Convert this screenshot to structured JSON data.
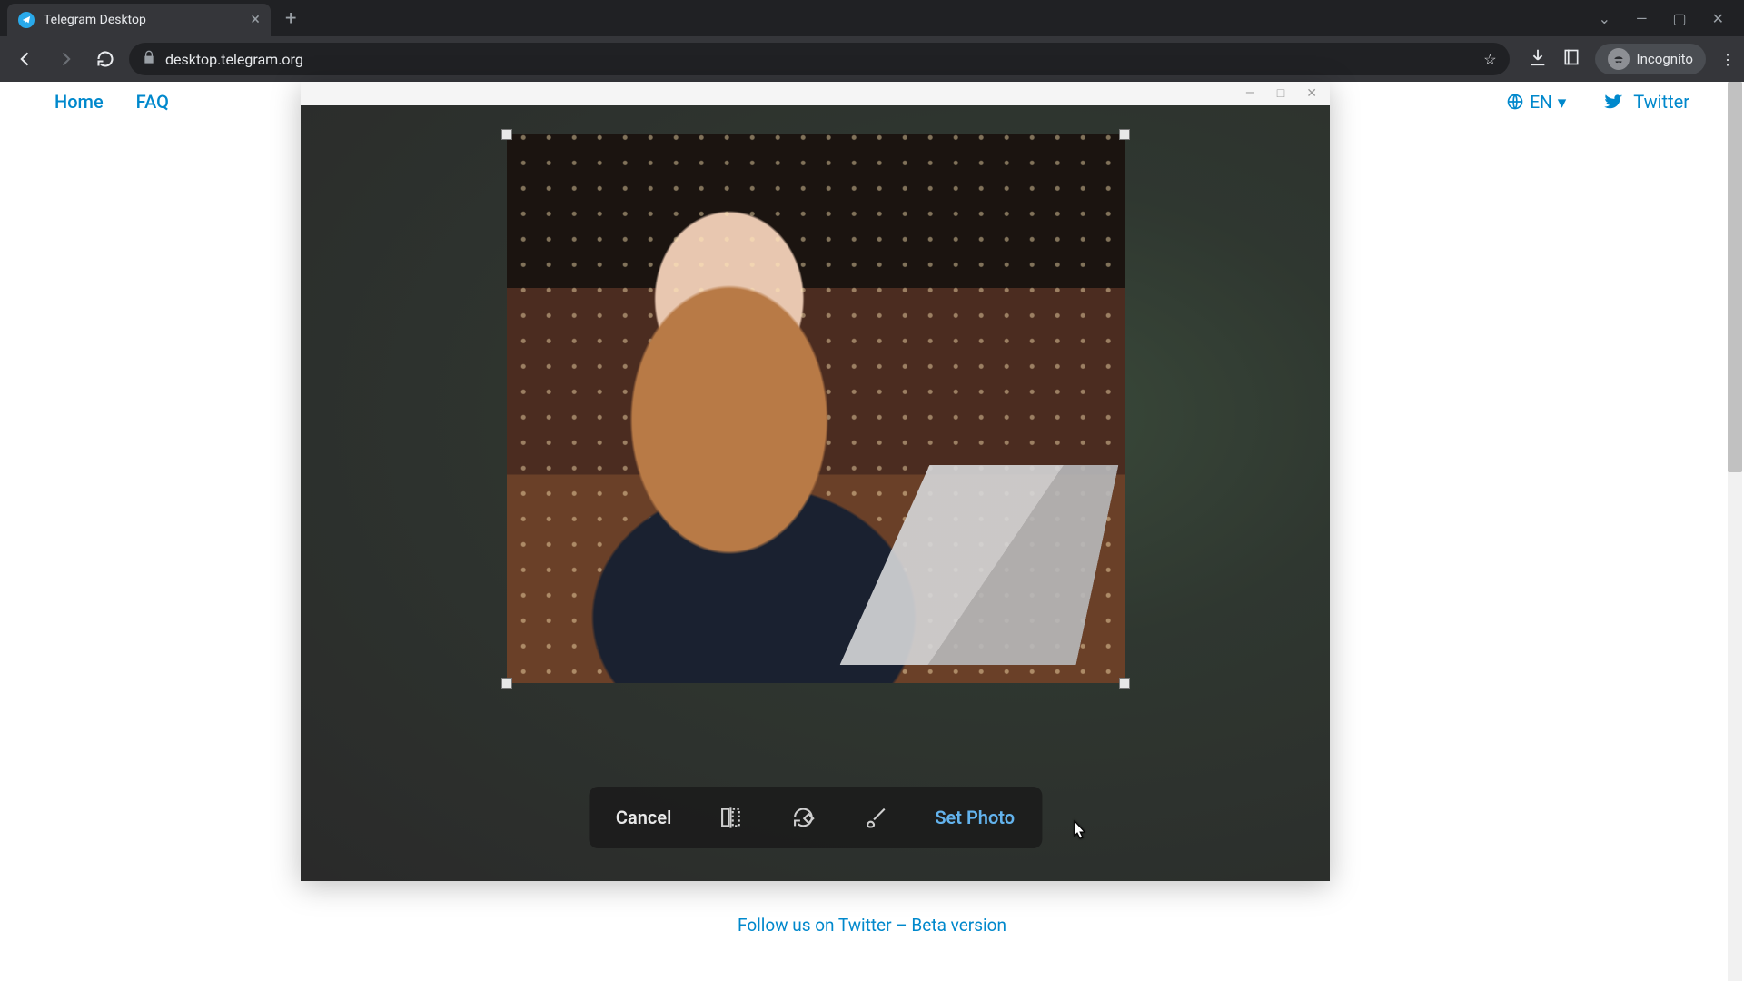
{
  "browser": {
    "tab_title": "Telegram Desktop",
    "url": "desktop.telegram.org",
    "incognito_label": "Incognito"
  },
  "page": {
    "nav": {
      "home": "Home",
      "faq": "FAQ"
    },
    "lang": "EN",
    "twitter": "Twitter",
    "footer": "Follow us on Twitter – Beta version"
  },
  "editor": {
    "cancel": "Cancel",
    "set_photo": "Set Photo"
  },
  "colors": {
    "accent": "#0088cc",
    "primary_action": "#63b3ed"
  }
}
